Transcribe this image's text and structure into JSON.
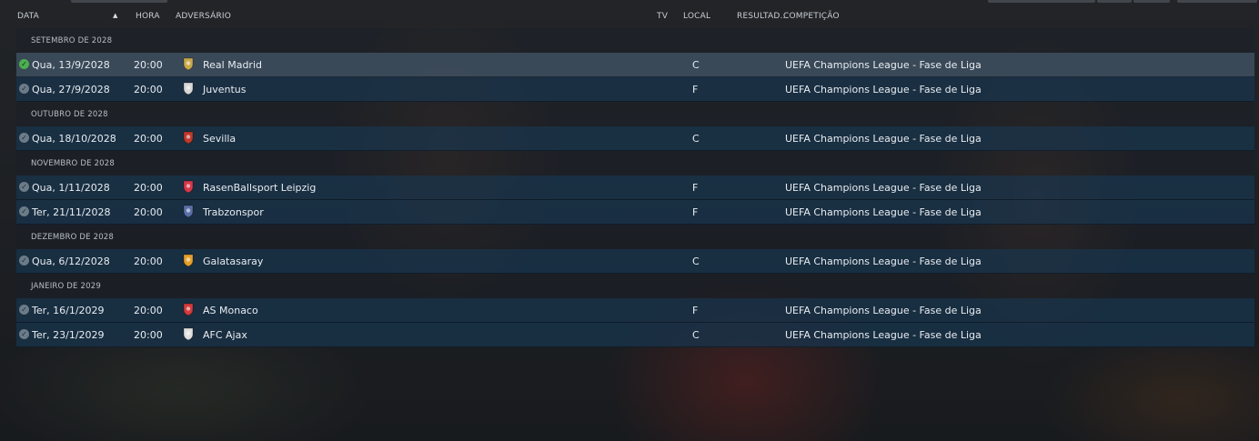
{
  "header": {
    "date": "DATA",
    "time": "HORA",
    "opponent": "ADVERSÁRIO",
    "tv": "TV",
    "venue": "LOCAL",
    "result": "RESULTAD...",
    "competition": "COMPETIÇÃO"
  },
  "months": [
    {
      "label": "SETEMBRO DE 2028"
    },
    {
      "label": "OUTUBRO DE 2028"
    },
    {
      "label": "NOVEMBRO DE 2028"
    },
    {
      "label": "DEZEMBRO DE 2028"
    },
    {
      "label": "JANEIRO DE 2029"
    }
  ],
  "matches": [
    {
      "date": "Qua, 13/9/2028",
      "time": "20:00",
      "opponent": "Real Madrid",
      "venue": "C",
      "competition": "UEFA Champions League - Fase de Liga",
      "crest_color": "#c9a94a"
    },
    {
      "date": "Qua, 27/9/2028",
      "time": "20:00",
      "opponent": "Juventus",
      "venue": "F",
      "competition": "UEFA Champions League - Fase de Liga",
      "crest_color": "#d8d8d8"
    },
    {
      "date": "Qua, 18/10/2028",
      "time": "20:00",
      "opponent": "Sevilla",
      "venue": "C",
      "competition": "UEFA Champions League - Fase de Liga",
      "crest_color": "#c0392b"
    },
    {
      "date": "Qua, 1/11/2028",
      "time": "20:00",
      "opponent": "RasenBallsport Leipzig",
      "venue": "F",
      "competition": "UEFA Champions League - Fase de Liga",
      "crest_color": "#d6384a"
    },
    {
      "date": "Ter, 21/11/2028",
      "time": "20:00",
      "opponent": "Trabzonspor",
      "venue": "F",
      "competition": "UEFA Champions League - Fase de Liga",
      "crest_color": "#5b6fa8"
    },
    {
      "date": "Qua, 6/12/2028",
      "time": "20:00",
      "opponent": "Galatasaray",
      "venue": "C",
      "competition": "UEFA Champions League - Fase de Liga",
      "crest_color": "#e6a02a"
    },
    {
      "date": "Ter, 16/1/2029",
      "time": "20:00",
      "opponent": "AS Monaco",
      "venue": "F",
      "competition": "UEFA Champions League - Fase de Liga",
      "crest_color": "#d33a3a"
    },
    {
      "date": "Ter, 23/1/2029",
      "time": "20:00",
      "opponent": "AFC Ajax",
      "venue": "C",
      "competition": "UEFA Champions League - Fase de Liga",
      "crest_color": "#e0e0e0"
    }
  ]
}
